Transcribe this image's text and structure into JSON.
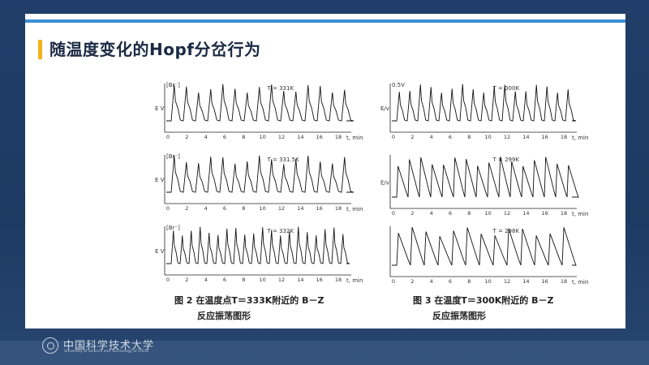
{
  "title": "随温度变化的Hopf分岔行为",
  "footer": {
    "university_cn": "中国科学技术大学",
    "university_en": "University of Science and Technology of China"
  },
  "colors": {
    "accent": "#f2b21a",
    "bar": "#3a8fd6",
    "background": "#1f3c66"
  },
  "figure": {
    "left_panels": [
      {
        "temperature": "T = 331K",
        "signal_label": "[Br⁻]",
        "ylabel": "E V",
        "xaxis": "t, min"
      },
      {
        "temperature": "T = 331.5K",
        "signal_label": "[Br⁻]",
        "ylabel": "E V",
        "xaxis": "t, min"
      },
      {
        "temperature": "T = 332K",
        "signal_label": "[Br⁻]",
        "ylabel": "E V",
        "xaxis": "t, min"
      }
    ],
    "right_panels": [
      {
        "temperature": "T = 300K",
        "signal_label": "0.5V",
        "ylabel": "E/v",
        "xaxis": "t, min"
      },
      {
        "temperature": "T = 299K",
        "signal_label": "",
        "ylabel": "E/v",
        "xaxis": "t, min"
      },
      {
        "temperature": "T = 298K",
        "signal_label": "",
        "ylabel": "",
        "xaxis": "t, min"
      }
    ],
    "ticks": [
      "0",
      "2",
      "4",
      "6",
      "8",
      "10",
      "12",
      "14",
      "16",
      "18"
    ],
    "caption_left_line1": "图 2   在温度点T＝333K附近的 B－Z",
    "caption_left_line2": "反应振荡图形",
    "caption_right_line1": "图 3   在温度T＝300K附近的 B－Z",
    "caption_right_line2": "反应振荡图形"
  }
}
